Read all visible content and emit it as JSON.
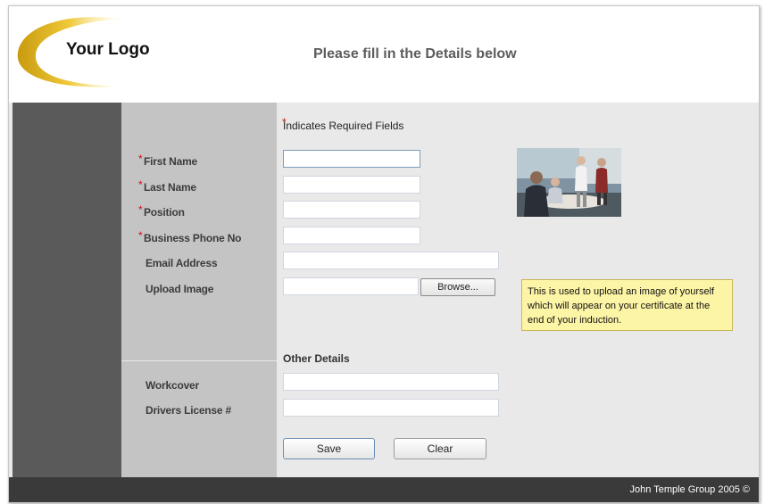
{
  "header": {
    "logo_text": "Your Logo",
    "title": "Please fill in the Details below"
  },
  "form": {
    "required_note": "Indicates Required Fields",
    "required_marker": "*",
    "fields": {
      "first_name": {
        "label": "First Name",
        "required": true,
        "value": ""
      },
      "last_name": {
        "label": "Last Name",
        "required": true,
        "value": ""
      },
      "position": {
        "label": "Position",
        "required": true,
        "value": ""
      },
      "business_phone": {
        "label": "Business Phone No",
        "required": true,
        "value": ""
      },
      "email": {
        "label": "Email Address",
        "required": false,
        "value": ""
      },
      "upload_image": {
        "label": "Upload Image",
        "required": false,
        "value": ""
      }
    },
    "browse_label": "Browse...",
    "upload_tooltip": "This is used to upload an image of yourself which will appear on your certificate at the end of your induction.",
    "other_details_heading": "Other Details",
    "other_fields": {
      "workcover": {
        "label": "Workcover",
        "value": ""
      },
      "drivers_license": {
        "label": "Drivers License #",
        "value": ""
      }
    },
    "save_label": "Save",
    "clear_label": "Clear"
  },
  "footer": {
    "copyright": "John Temple Group 2005 ©"
  },
  "colors": {
    "accent_gold": "#e8b820",
    "required_red": "#cc1111",
    "tooltip_yellow": "#fdf5a6",
    "sidebar_dark": "#5a5a5a",
    "label_column": "#c4c4c4"
  }
}
